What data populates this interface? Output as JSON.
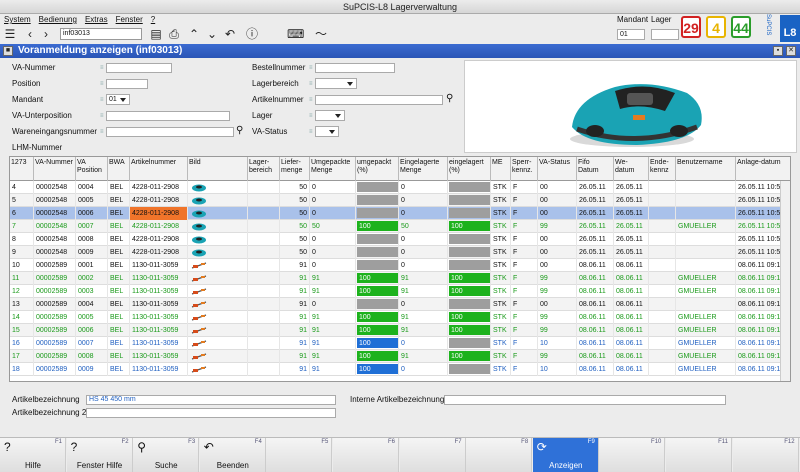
{
  "window": {
    "title": "SuPCIS-L8 Lagerverwaltung"
  },
  "menu": [
    "System",
    "Bedienung",
    "Extras",
    "Fenster",
    "?"
  ],
  "toolbar": {
    "doc_input": "inf03013"
  },
  "top_right": {
    "mandant_label": "Mandant",
    "lager_label": "Lager",
    "mandant_value": "01",
    "badges": [
      {
        "value": "29",
        "color": "#d22222"
      },
      {
        "value": "4",
        "color": "#e8b400"
      },
      {
        "value": "44",
        "color": "#2a9d2a"
      }
    ],
    "brand": "L8",
    "brand_small": "SuPCIS"
  },
  "panel": {
    "title": "Voranmeldung anzeigen (inf03013)"
  },
  "form": {
    "va_nummer": "VA-Nummer",
    "position": "Position",
    "mandant": "Mandant",
    "mandant_value": "01",
    "va_unterposition": "VA-Unterposition",
    "wareneingangsnummer": "Wareneingangsnummer",
    "lhm_nummer": "LHM-Nummer",
    "bestellnummer": "Bestellnummer",
    "lagerbereich": "Lagerbereich",
    "artikelnummer": "Artikelnummer",
    "lager": "Lager",
    "va_status": "VA-Status"
  },
  "grid": {
    "count": "1273",
    "columns": [
      "VA-Nummer",
      "VA Position",
      "BWA",
      "Artikelnummer",
      "Bild",
      "Lager-bereich",
      "Liefer-menge",
      "Umgepackte Menge",
      "umgepackt (%)",
      "Eingelagerte Menge",
      "eingelagert (%)",
      "ME",
      "Sperr-kennz.",
      "VA-Status",
      "Fifo Datum",
      "We-datum",
      "Ende-kennz",
      "Benutzername",
      "Anlage-datum"
    ],
    "rows": [
      {
        "n": "4",
        "va": "00002548",
        "pos": "0004",
        "bwa": "BEL",
        "art": "4228-011-2908",
        "bild": "teal",
        "liefer": "50",
        "umg": "0",
        "umgp": "",
        "umgp_val": 0,
        "umgp_color": "#9e9e9e",
        "einl": "0",
        "einlp": "",
        "einlp_val": 0,
        "einlp_color": "#9e9e9e",
        "me": "STK",
        "sperr": "F",
        "st": "00",
        "fifo": "26.05.11",
        "we": "26.05.11",
        "ende": "",
        "user": "",
        "anlage": "26.05.11 10:5",
        "color": "#111",
        "hl": false
      },
      {
        "n": "5",
        "va": "00002548",
        "pos": "0005",
        "bwa": "BEL",
        "art": "4228-011-2908",
        "bild": "teal",
        "liefer": "50",
        "umg": "0",
        "umgp": "",
        "umgp_val": 0,
        "umgp_color": "#9e9e9e",
        "einl": "0",
        "einlp": "",
        "einlp_val": 0,
        "einlp_color": "#9e9e9e",
        "me": "STK",
        "sperr": "F",
        "st": "00",
        "fifo": "26.05.11",
        "we": "26.05.11",
        "ende": "",
        "user": "",
        "anlage": "26.05.11 10:5",
        "color": "#111",
        "hl": false
      },
      {
        "n": "6",
        "va": "00002548",
        "pos": "0006",
        "bwa": "BEL",
        "art": "4228-011-2908",
        "bild": "teal",
        "liefer": "50",
        "umg": "0",
        "umgp": "",
        "umgp_val": 0,
        "umgp_color": "#9e9e9e",
        "einl": "0",
        "einlp": "",
        "einlp_val": 0,
        "einlp_color": "#9e9e9e",
        "me": "STK",
        "sperr": "F",
        "st": "00",
        "fifo": "26.05.11",
        "we": "26.05.11",
        "ende": "",
        "user": "",
        "anlage": "26.05.11 10:5",
        "color": "#111",
        "hl": true
      },
      {
        "n": "7",
        "va": "00002548",
        "pos": "0007",
        "bwa": "BEL",
        "art": "4228-011-2908",
        "bild": "teal",
        "liefer": "50",
        "umg": "50",
        "umgp": "100",
        "umgp_val": 100,
        "umgp_color": "#1db21d",
        "einl": "50",
        "einlp": "100",
        "einlp_val": 100,
        "einlp_color": "#1db21d",
        "me": "STK",
        "sperr": "F",
        "st": "99",
        "fifo": "26.05.11",
        "we": "26.05.11",
        "ende": "",
        "user": "GMUELLER",
        "anlage": "26.05.11 10:5",
        "color": "#1a9a1a",
        "hl": false
      },
      {
        "n": "8",
        "va": "00002548",
        "pos": "0008",
        "bwa": "BEL",
        "art": "4228-011-2908",
        "bild": "teal",
        "liefer": "50",
        "umg": "0",
        "umgp": "",
        "umgp_val": 0,
        "umgp_color": "#9e9e9e",
        "einl": "0",
        "einlp": "",
        "einlp_val": 0,
        "einlp_color": "#9e9e9e",
        "me": "STK",
        "sperr": "F",
        "st": "00",
        "fifo": "26.05.11",
        "we": "26.05.11",
        "ende": "",
        "user": "",
        "anlage": "26.05.11 10:5",
        "color": "#111",
        "hl": false
      },
      {
        "n": "9",
        "va": "00002548",
        "pos": "0009",
        "bwa": "BEL",
        "art": "4228-011-2908",
        "bild": "teal",
        "liefer": "50",
        "umg": "0",
        "umgp": "",
        "umgp_val": 0,
        "umgp_color": "#9e9e9e",
        "einl": "0",
        "einlp": "",
        "einlp_val": 0,
        "einlp_color": "#9e9e9e",
        "me": "STK",
        "sperr": "F",
        "st": "00",
        "fifo": "26.05.11",
        "we": "26.05.11",
        "ende": "",
        "user": "",
        "anlage": "26.05.11 10:5",
        "color": "#111",
        "hl": false
      },
      {
        "n": "10",
        "va": "00002589",
        "pos": "0001",
        "bwa": "BEL",
        "art": "1130-011-3059",
        "bild": "trimmer",
        "liefer": "91",
        "umg": "0",
        "umgp": "",
        "umgp_val": 0,
        "umgp_color": "#9e9e9e",
        "einl": "0",
        "einlp": "",
        "einlp_val": 0,
        "einlp_color": "#9e9e9e",
        "me": "STK",
        "sperr": "F",
        "st": "00",
        "fifo": "08.06.11",
        "we": "08.06.11",
        "ende": "",
        "user": "",
        "anlage": "08.06.11 09:1",
        "color": "#111",
        "hl": false
      },
      {
        "n": "11",
        "va": "00002589",
        "pos": "0002",
        "bwa": "BEL",
        "art": "1130-011-3059",
        "bild": "trimmer",
        "liefer": "91",
        "umg": "91",
        "umgp": "100",
        "umgp_val": 100,
        "umgp_color": "#1db21d",
        "einl": "91",
        "einlp": "100",
        "einlp_val": 100,
        "einlp_color": "#1db21d",
        "me": "STK",
        "sperr": "F",
        "st": "99",
        "fifo": "08.06.11",
        "we": "08.06.11",
        "ende": "",
        "user": "GMUELLER",
        "anlage": "08.06.11 09:1",
        "color": "#1a9a1a",
        "hl": false
      },
      {
        "n": "12",
        "va": "00002589",
        "pos": "0003",
        "bwa": "BEL",
        "art": "1130-011-3059",
        "bild": "trimmer",
        "liefer": "91",
        "umg": "91",
        "umgp": "100",
        "umgp_val": 100,
        "umgp_color": "#1db21d",
        "einl": "91",
        "einlp": "100",
        "einlp_val": 100,
        "einlp_color": "#1db21d",
        "me": "STK",
        "sperr": "F",
        "st": "99",
        "fifo": "08.06.11",
        "we": "08.06.11",
        "ende": "",
        "user": "GMUELLER",
        "anlage": "08.06.11 09:1",
        "color": "#1a9a1a",
        "hl": false
      },
      {
        "n": "13",
        "va": "00002589",
        "pos": "0004",
        "bwa": "BEL",
        "art": "1130-011-3059",
        "bild": "trimmer",
        "liefer": "91",
        "umg": "0",
        "umgp": "",
        "umgp_val": 0,
        "umgp_color": "#9e9e9e",
        "einl": "0",
        "einlp": "",
        "einlp_val": 0,
        "einlp_color": "#9e9e9e",
        "me": "STK",
        "sperr": "F",
        "st": "00",
        "fifo": "08.06.11",
        "we": "08.06.11",
        "ende": "",
        "user": "",
        "anlage": "08.06.11 09:1",
        "color": "#111",
        "hl": false
      },
      {
        "n": "14",
        "va": "00002589",
        "pos": "0005",
        "bwa": "BEL",
        "art": "1130-011-3059",
        "bild": "trimmer",
        "liefer": "91",
        "umg": "91",
        "umgp": "100",
        "umgp_val": 100,
        "umgp_color": "#1db21d",
        "einl": "91",
        "einlp": "100",
        "einlp_val": 100,
        "einlp_color": "#1db21d",
        "me": "STK",
        "sperr": "F",
        "st": "99",
        "fifo": "08.06.11",
        "we": "08.06.11",
        "ende": "",
        "user": "GMUELLER",
        "anlage": "08.06.11 09:1",
        "color": "#1a9a1a",
        "hl": false
      },
      {
        "n": "15",
        "va": "00002589",
        "pos": "0006",
        "bwa": "BEL",
        "art": "1130-011-3059",
        "bild": "trimmer",
        "liefer": "91",
        "umg": "91",
        "umgp": "100",
        "umgp_val": 100,
        "umgp_color": "#1db21d",
        "einl": "91",
        "einlp": "100",
        "einlp_val": 100,
        "einlp_color": "#1db21d",
        "me": "STK",
        "sperr": "F",
        "st": "99",
        "fifo": "08.06.11",
        "we": "08.06.11",
        "ende": "",
        "user": "GMUELLER",
        "anlage": "08.06.11 09:1",
        "color": "#1a9a1a",
        "hl": false
      },
      {
        "n": "16",
        "va": "00002589",
        "pos": "0007",
        "bwa": "BEL",
        "art": "1130-011-3059",
        "bild": "trimmer",
        "liefer": "91",
        "umg": "91",
        "umgp": "100",
        "umgp_val": 100,
        "umgp_color": "#1f6fd6",
        "einl": "0",
        "einlp": "",
        "einlp_val": 0,
        "einlp_color": "#9e9e9e",
        "me": "STK",
        "sperr": "F",
        "st": "10",
        "fifo": "08.06.11",
        "we": "08.06.11",
        "ende": "",
        "user": "GMUELLER",
        "anlage": "08.06.11 09:1",
        "color": "#1f5fc0",
        "hl": false
      },
      {
        "n": "17",
        "va": "00002589",
        "pos": "0008",
        "bwa": "BEL",
        "art": "1130-011-3059",
        "bild": "trimmer",
        "liefer": "91",
        "umg": "91",
        "umgp": "100",
        "umgp_val": 100,
        "umgp_color": "#1db21d",
        "einl": "91",
        "einlp": "100",
        "einlp_val": 100,
        "einlp_color": "#1db21d",
        "me": "STK",
        "sperr": "F",
        "st": "99",
        "fifo": "08.06.11",
        "we": "08.06.11",
        "ende": "",
        "user": "GMUELLER",
        "anlage": "08.06.11 09:1",
        "color": "#1a9a1a",
        "hl": false
      },
      {
        "n": "18",
        "va": "00002589",
        "pos": "0009",
        "bwa": "BEL",
        "art": "1130-011-3059",
        "bild": "trimmer",
        "liefer": "91",
        "umg": "91",
        "umgp": "100",
        "umgp_val": 100,
        "umgp_color": "#1f6fd6",
        "einl": "0",
        "einlp": "",
        "einlp_val": 0,
        "einlp_color": "#9e9e9e",
        "me": "STK",
        "sperr": "F",
        "st": "10",
        "fifo": "08.06.11",
        "we": "08.06.11",
        "ende": "",
        "user": "GMUELLER",
        "anlage": "08.06.11 09:1",
        "color": "#1f5fc0",
        "hl": false
      }
    ]
  },
  "bottom": {
    "artikelbez_label": "Artikelbezeichnung",
    "artikelbez_value": "HS 45 450 mm",
    "artikelbez2_label": "Artikelbezeichnung 2",
    "interne_label": "Interne Artikelbezeichnung"
  },
  "fkeys": [
    {
      "num": "F1",
      "label": "Hilfe",
      "icon": "help-icon",
      "glyph": "?",
      "active": false
    },
    {
      "num": "F2",
      "label": "Fenster Hilfe",
      "icon": "help-icon",
      "glyph": "?",
      "active": false
    },
    {
      "num": "F3",
      "label": "Suche",
      "icon": "search-icon",
      "glyph": "⚲",
      "active": false
    },
    {
      "num": "F4",
      "label": "Beenden",
      "icon": "back-icon",
      "glyph": "↶",
      "active": false
    },
    {
      "num": "F5",
      "label": "",
      "icon": "",
      "glyph": "",
      "active": false
    },
    {
      "num": "F6",
      "label": "",
      "icon": "",
      "glyph": "",
      "active": false
    },
    {
      "num": "F7",
      "label": "",
      "icon": "",
      "glyph": "",
      "active": false
    },
    {
      "num": "F8",
      "label": "",
      "icon": "",
      "glyph": "",
      "active": false
    },
    {
      "num": "F9",
      "label": "Anzeigen",
      "icon": "refresh-icon",
      "glyph": "⟳",
      "active": true
    },
    {
      "num": "F10",
      "label": "",
      "icon": "",
      "glyph": "",
      "active": false
    },
    {
      "num": "F11",
      "label": "",
      "icon": "",
      "glyph": "",
      "active": false
    },
    {
      "num": "F12",
      "label": "",
      "icon": "",
      "glyph": "",
      "active": false
    }
  ]
}
